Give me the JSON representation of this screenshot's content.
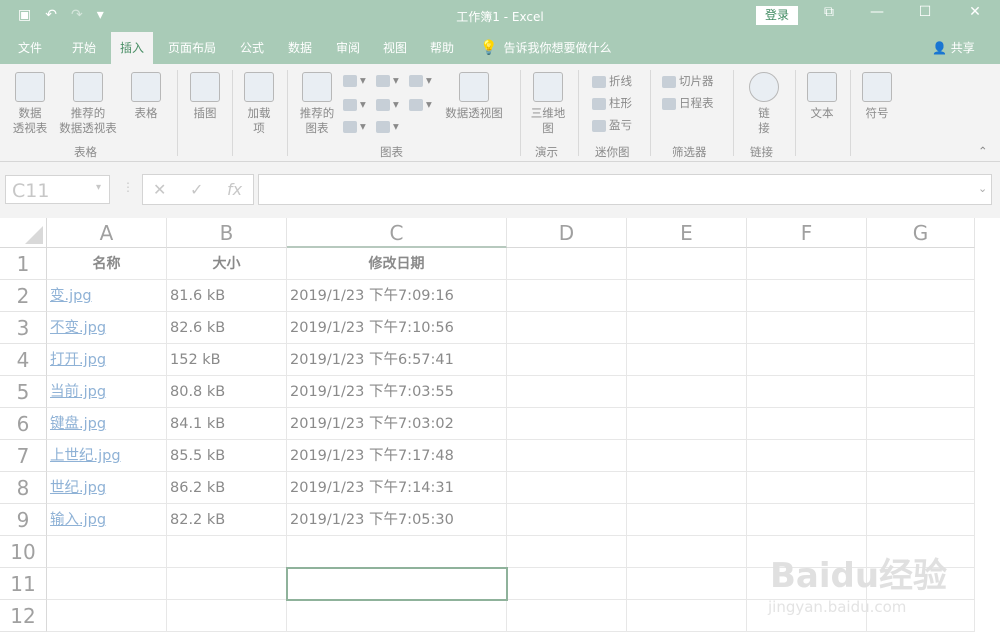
{
  "titlebar": {
    "title": "工作簿1  -  Excel",
    "login": "登录",
    "qat": {
      "save": "▣",
      "undo": "↶",
      "redo": "↷",
      "more": "▾"
    },
    "window_buttons": {
      "ribbon_options": "⧉",
      "minimize": "—",
      "restore": "☐",
      "close": "✕"
    }
  },
  "tabs": [
    {
      "label": "文件"
    },
    {
      "label": "开始"
    },
    {
      "label": "插入"
    },
    {
      "label": "页面布局"
    },
    {
      "label": "公式"
    },
    {
      "label": "数据"
    },
    {
      "label": "审阅"
    },
    {
      "label": "视图"
    },
    {
      "label": "帮助"
    }
  ],
  "tellme": "告诉我你想要做什么",
  "share": "共享",
  "ribbon": {
    "pivot": "数据\n透视表",
    "rec_pivot": "推荐的\n数据透视表",
    "table": "表格",
    "group_tables": "表格",
    "illustrations": "插图",
    "addins": "加载\n项",
    "rec_charts": "推荐的\n图表",
    "pivot_chart": "数据透视图",
    "group_charts": "图表",
    "map3d": "三维地\n图",
    "group_tours": "演示",
    "spark_line": "折线",
    "spark_column": "柱形",
    "spark_winloss": "盈亏",
    "group_sparklines": "迷你图",
    "slicer": "切片器",
    "timeline": "日程表",
    "group_filters": "筛选器",
    "link": "链\n接",
    "group_links": "链接",
    "text": "文本",
    "symbols": "符号"
  },
  "formula_bar": {
    "name_box": "C11",
    "cancel": "✕",
    "enter": "✓",
    "fx": "fx"
  },
  "columns": [
    "A",
    "B",
    "C",
    "D",
    "E",
    "F",
    "G"
  ],
  "rows": [
    "1",
    "2",
    "3",
    "4",
    "5",
    "6",
    "7",
    "8",
    "9",
    "10",
    "11",
    "12"
  ],
  "table": {
    "headers": [
      "名称",
      "大小",
      "修改日期"
    ],
    "rows": [
      [
        "变.jpg",
        "81.6 kB",
        "2019/1/23 下午7:09:16"
      ],
      [
        "不变.jpg",
        "82.6 kB",
        "2019/1/23 下午7:10:56"
      ],
      [
        "打开.jpg",
        "152 kB",
        "2019/1/23 下午6:57:41"
      ],
      [
        "当前.jpg",
        "80.8 kB",
        "2019/1/23 下午7:03:55"
      ],
      [
        "键盘.jpg",
        "84.1 kB",
        "2019/1/23 下午7:03:02"
      ],
      [
        "上世纪.jpg",
        "85.5 kB",
        "2019/1/23 下午7:17:48"
      ],
      [
        "世纪.jpg",
        "86.2 kB",
        "2019/1/23 下午7:14:31"
      ],
      [
        "输入.jpg",
        "82.2 kB",
        "2019/1/23 下午7:05:30"
      ]
    ]
  },
  "watermark": {
    "logo": "Baidu经验",
    "url": "jingyan.baidu.com"
  }
}
